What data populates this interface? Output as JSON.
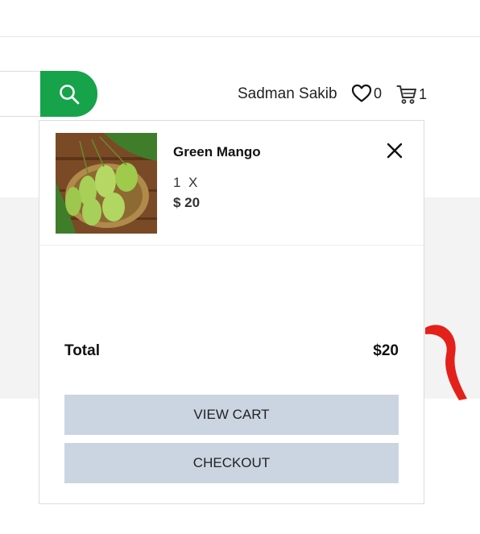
{
  "header": {
    "user_name": "Sadman Sakib",
    "wishlist_count": "0",
    "cart_count": "1",
    "accent_color": "#16a34a"
  },
  "icons": {
    "search": "search-icon",
    "wishlist": "heart-icon",
    "cart": "cart-icon",
    "remove": "close-icon"
  },
  "cart_dropdown": {
    "items": [
      {
        "name": "Green Mango",
        "quantity": "1",
        "multiply": "X",
        "price": "$ 20"
      }
    ],
    "total_label": "Total",
    "total_value": "$20",
    "view_cart_label": "VIEW CART",
    "checkout_label": "CHECKOUT",
    "button_color": "#cbd5e1"
  }
}
